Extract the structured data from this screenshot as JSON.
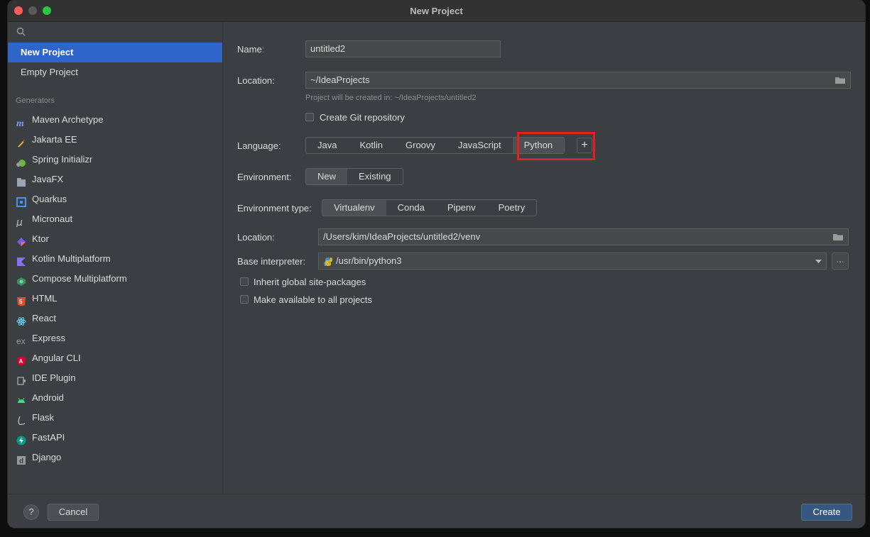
{
  "window": {
    "title": "New Project"
  },
  "sidebar": {
    "items": [
      {
        "label": "New Project"
      },
      {
        "label": "Empty Project"
      }
    ],
    "generators_label": "Generators",
    "generators": [
      {
        "label": "Maven Archetype",
        "icon": "maven-icon"
      },
      {
        "label": "Jakarta EE",
        "icon": "jakarta-icon"
      },
      {
        "label": "Spring Initializr",
        "icon": "spring-icon"
      },
      {
        "label": "JavaFX",
        "icon": "javafx-icon"
      },
      {
        "label": "Quarkus",
        "icon": "quarkus-icon"
      },
      {
        "label": "Micronaut",
        "icon": "micronaut-icon"
      },
      {
        "label": "Ktor",
        "icon": "ktor-icon"
      },
      {
        "label": "Kotlin Multiplatform",
        "icon": "kotlin-icon"
      },
      {
        "label": "Compose Multiplatform",
        "icon": "compose-icon"
      },
      {
        "label": "HTML",
        "icon": "html5-icon"
      },
      {
        "label": "React",
        "icon": "react-icon"
      },
      {
        "label": "Express",
        "icon": "express-icon"
      },
      {
        "label": "Angular CLI",
        "icon": "angular-icon"
      },
      {
        "label": "IDE Plugin",
        "icon": "plugin-icon"
      },
      {
        "label": "Android",
        "icon": "android-icon"
      },
      {
        "label": "Flask",
        "icon": "flask-icon"
      },
      {
        "label": "FastAPI",
        "icon": "fastapi-icon"
      },
      {
        "label": "Django",
        "icon": "django-icon"
      }
    ]
  },
  "form": {
    "name_label": "Name:",
    "name_value": "untitled2",
    "location_label": "Location:",
    "location_value": "~/IdeaProjects",
    "location_hint": "Project will be created in: ~/IdeaProjects/untitled2",
    "git_label": "Create Git repository",
    "language_label": "Language:",
    "languages": [
      "Java",
      "Kotlin",
      "Groovy",
      "JavaScript",
      "Python"
    ],
    "selected_language": "Python",
    "add_symbol": "+",
    "environment_label": "Environment:",
    "environments": [
      "New",
      "Existing"
    ],
    "env_type_label": "Environment type:",
    "env_types": [
      "Virtualenv",
      "Conda",
      "Pipenv",
      "Poetry"
    ],
    "venv_location_label": "Location:",
    "venv_location_value": "/Users/kim/IdeaProjects/untitled2/venv",
    "interpreter_label": "Base interpreter:",
    "interpreter_value": "/usr/bin/python3",
    "browse_label": "...",
    "inherit_label": "Inherit global site-packages",
    "available_label": "Make available to all projects"
  },
  "footer": {
    "help": "?",
    "cancel": "Cancel",
    "create": "Create"
  },
  "colors": {
    "accent": "#2f65ca",
    "highlight": "#e3231b",
    "create": "#365880"
  }
}
